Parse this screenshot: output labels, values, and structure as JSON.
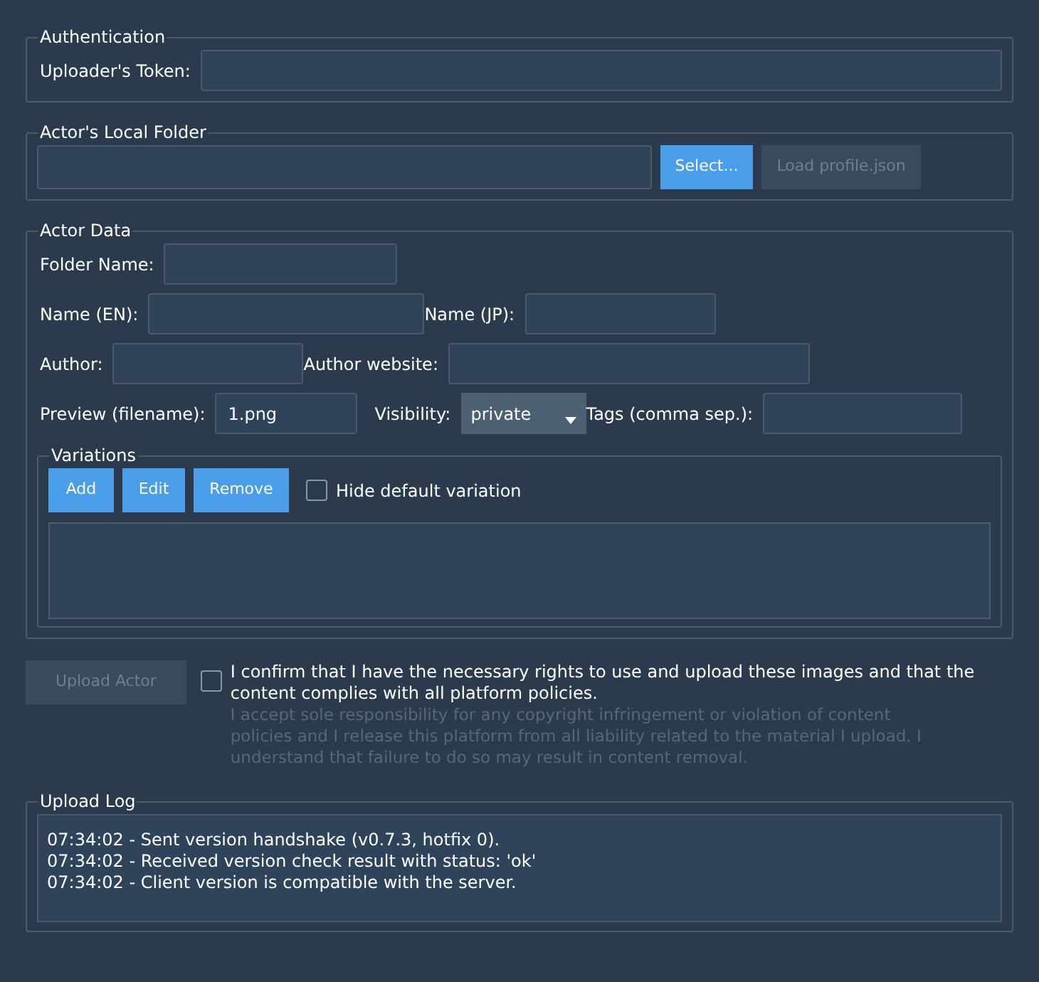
{
  "authentication": {
    "title": "Authentication",
    "fields": [
      {
        "label": "Uploader's Token:"
      }
    ]
  },
  "local_folder": {
    "title": "Actor's Local Folder",
    "buttons": [
      {
        "label": "Select...",
        "disabled": false
      },
      {
        "label": "Load profile.json",
        "disabled": true
      }
    ]
  },
  "actor_data": {
    "title": "Actor Data",
    "rows": [
      [
        {
          "kind": "text",
          "label": "Folder Name:"
        }
      ],
      [
        {
          "kind": "text",
          "label": "Name (EN):"
        },
        {
          "kind": "text",
          "label": "Name (JP):"
        }
      ],
      [
        {
          "kind": "text",
          "label": "Author:"
        },
        {
          "kind": "text",
          "label": "Author website:"
        }
      ],
      [
        {
          "kind": "text",
          "label": "Preview (filename):",
          "value": "1.png"
        },
        {
          "kind": "dropdown",
          "label": "Visibility:",
          "value": "private"
        },
        {
          "kind": "text",
          "label": "Tags (comma sep.):"
        }
      ]
    ],
    "variations": {
      "title": "Variations",
      "buttons": [
        {
          "label": "Add",
          "disabled": false
        },
        {
          "label": "Edit",
          "disabled": false
        },
        {
          "label": "Remove",
          "disabled": false
        }
      ],
      "checkbox": {
        "label": "Hide default variation",
        "checked": false
      }
    }
  },
  "upload": {
    "button": {
      "label": "Upload Actor",
      "disabled": true
    },
    "consent": {
      "label": "I confirm that I have the necessary rights to use and upload these images and that the content complies with all platform policies.",
      "checked": false
    },
    "disclaimer": "I accept sole responsibility for any copyright infringement or violation of content policies and I release this platform from all liability related to the material I upload. I understand that failure to do so may result in content removal."
  },
  "upload_log": {
    "title": "Upload Log",
    "lines": [
      "07:34:02 - Sent version handshake (v0.7.3, hotfix 0).",
      "07:34:02 - Received version check result with status: 'ok'",
      "07:34:02 - Client version is compatible with the server."
    ]
  }
}
